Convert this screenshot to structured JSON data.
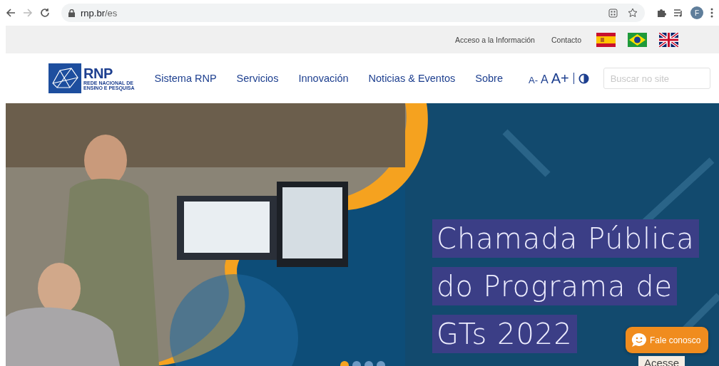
{
  "browser": {
    "url_host": "rnp.br",
    "url_path": "/es",
    "profile_initial": "F"
  },
  "top_bar": {
    "links": [
      "Acceso a la Información",
      "Contacto"
    ]
  },
  "nav": {
    "logo": {
      "title": "RNP",
      "subtitle": [
        "REDE NACIONAL DE",
        "ENSINO E PESQUISA"
      ]
    },
    "items": [
      "Sistema RNP",
      "Servicios",
      "Innovación",
      "Noticias & Eventos",
      "Sobre"
    ],
    "font_sizes": [
      "A-",
      "A",
      "A+"
    ],
    "search": {
      "placeholder": "Buscar no site"
    }
  },
  "hero": {
    "headline_lines": [
      "Chamada Pública",
      "do Programa de",
      "GTs 2022"
    ],
    "button": "Acesse",
    "slides": [
      {
        "selected": true
      },
      {
        "selected": false
      },
      {
        "selected": false
      },
      {
        "selected": false
      }
    ]
  },
  "chat": {
    "label": "Fale conosco"
  }
}
